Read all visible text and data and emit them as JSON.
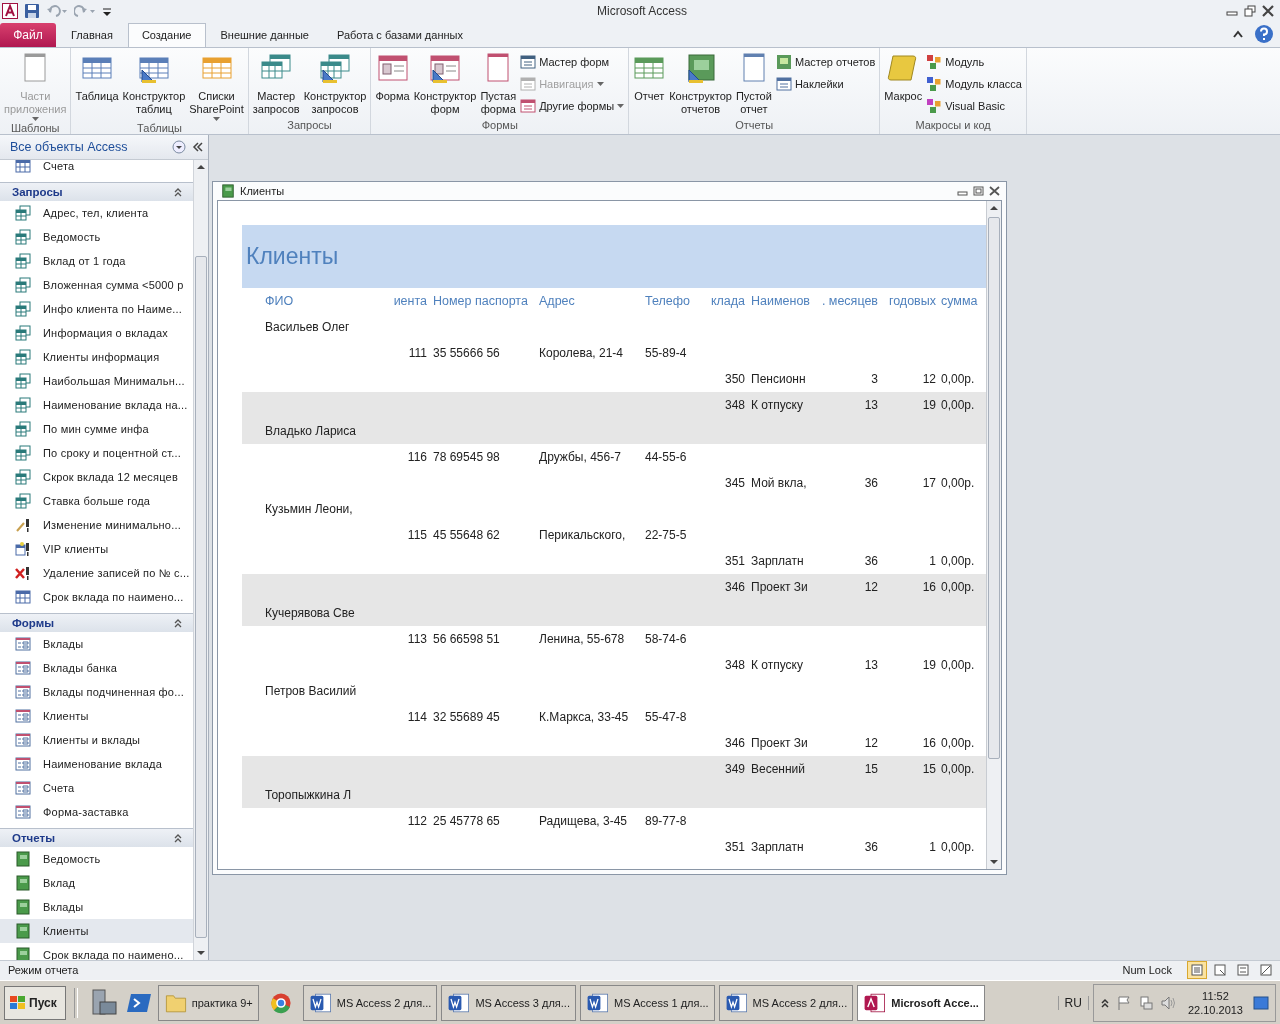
{
  "window": {
    "title": "Microsoft Access"
  },
  "ribbon": {
    "file_tab": "Файл",
    "tabs": [
      {
        "label": "Главная",
        "selected": false
      },
      {
        "label": "Создание",
        "selected": true
      },
      {
        "label": "Внешние данные",
        "selected": false
      },
      {
        "label": "Работа с базами данных",
        "selected": false
      }
    ],
    "groups": [
      {
        "label": "Шаблоны",
        "buttons": [
          {
            "kind": "large",
            "lines": [
              "Части",
              "приложения"
            ],
            "disabled": true,
            "dropdown": true
          }
        ]
      },
      {
        "label": "Таблицы",
        "buttons": [
          {
            "kind": "large",
            "lines": [
              "Таблица"
            ],
            "disabled": false,
            "dropdown": false
          },
          {
            "kind": "large",
            "lines": [
              "Конструктор",
              "таблиц"
            ],
            "disabled": false,
            "dropdown": false
          },
          {
            "kind": "large",
            "lines": [
              "Списки",
              "SharePoint"
            ],
            "disabled": false,
            "dropdown": true
          }
        ]
      },
      {
        "label": "Запросы",
        "buttons": [
          {
            "kind": "large",
            "lines": [
              "Мастер",
              "запросов"
            ],
            "disabled": false,
            "dropdown": false
          },
          {
            "kind": "large",
            "lines": [
              "Конструктор",
              "запросов"
            ],
            "disabled": false,
            "dropdown": false
          }
        ]
      },
      {
        "label": "Формы",
        "buttons": [
          {
            "kind": "large",
            "lines": [
              "Форма"
            ],
            "disabled": false,
            "dropdown": false
          },
          {
            "kind": "large",
            "lines": [
              "Конструктор",
              "форм"
            ],
            "disabled": false,
            "dropdown": false
          },
          {
            "kind": "large",
            "lines": [
              "Пустая",
              "форма"
            ],
            "disabled": false,
            "dropdown": false
          },
          {
            "kind": "small",
            "lines": [
              "Мастер форм"
            ],
            "disabled": false,
            "dropdown": false
          },
          {
            "kind": "small",
            "lines": [
              "Навигация"
            ],
            "disabled": true,
            "dropdown": true
          },
          {
            "kind": "small",
            "lines": [
              "Другие формы"
            ],
            "disabled": false,
            "dropdown": true
          }
        ]
      },
      {
        "label": "Отчеты",
        "buttons": [
          {
            "kind": "large",
            "lines": [
              "Отчет"
            ],
            "disabled": false,
            "dropdown": false
          },
          {
            "kind": "large",
            "lines": [
              "Конструктор",
              "отчетов"
            ],
            "disabled": false,
            "dropdown": false
          },
          {
            "kind": "large",
            "lines": [
              "Пустой",
              "отчет"
            ],
            "disabled": false,
            "dropdown": false
          },
          {
            "kind": "small",
            "lines": [
              "Мастер отчетов"
            ],
            "disabled": false,
            "dropdown": false
          },
          {
            "kind": "small",
            "lines": [
              "Наклейки"
            ],
            "disabled": false,
            "dropdown": false
          }
        ]
      },
      {
        "label": "Макросы и код",
        "buttons": [
          {
            "kind": "large",
            "lines": [
              "Макрос"
            ],
            "disabled": false,
            "dropdown": false
          },
          {
            "kind": "small",
            "lines": [
              "Модуль"
            ],
            "disabled": false,
            "dropdown": false
          },
          {
            "kind": "small",
            "lines": [
              "Модуль класса"
            ],
            "disabled": false,
            "dropdown": false
          },
          {
            "kind": "small",
            "lines": [
              "Visual Basic"
            ],
            "disabled": false,
            "dropdown": false
          }
        ]
      }
    ]
  },
  "nav": {
    "header": "Все объекты Access",
    "groups": [
      {
        "items": [
          {
            "label": "Счета",
            "kind": "table",
            "selected": false
          }
        ]
      },
      {
        "title": "Запросы",
        "items": [
          {
            "label": "Адрес, тел, клиента",
            "kind": "query",
            "selected": false
          },
          {
            "label": "Ведомость",
            "kind": "query",
            "selected": false
          },
          {
            "label": "Вклад от 1 года",
            "kind": "query",
            "selected": false
          },
          {
            "label": "Вложенная сумма <5000 р",
            "kind": "query",
            "selected": false
          },
          {
            "label": "Инфо клиента по Наиме...",
            "kind": "query",
            "selected": false
          },
          {
            "label": "Информация о вкладах",
            "kind": "query",
            "selected": false
          },
          {
            "label": "Клиенты информация",
            "kind": "query",
            "selected": false
          },
          {
            "label": "Наибольшая Минимальн...",
            "kind": "query",
            "selected": false
          },
          {
            "label": "Наименование вклада на...",
            "kind": "query",
            "selected": false
          },
          {
            "label": "По мин сумме инфа",
            "kind": "query",
            "selected": false
          },
          {
            "label": "По сроку и поцентной ст...",
            "kind": "query",
            "selected": false
          },
          {
            "label": "Скрок вклада 12 месяцев",
            "kind": "query",
            "selected": false
          },
          {
            "label": "Ставка больше года",
            "kind": "query",
            "selected": false
          },
          {
            "label": "Изменение минимально...",
            "kind": "update",
            "selected": false
          },
          {
            "label": "VIP клиенты",
            "kind": "maketable",
            "selected": false
          },
          {
            "label": "Удаление записей по № с...",
            "kind": "delete",
            "selected": false
          },
          {
            "label": "Срок вклада по наимено...",
            "kind": "crosstab",
            "selected": false
          }
        ]
      },
      {
        "title": "Формы",
        "items": [
          {
            "label": "Вклады",
            "kind": "form",
            "selected": false
          },
          {
            "label": "Вклады банка",
            "kind": "form",
            "selected": false
          },
          {
            "label": "Вклады подчиненная фо...",
            "kind": "form",
            "selected": false
          },
          {
            "label": "Клиенты",
            "kind": "form",
            "selected": false
          },
          {
            "label": "Клиенты и вклады",
            "kind": "form",
            "selected": false
          },
          {
            "label": "Наименование вклада",
            "kind": "form",
            "selected": false
          },
          {
            "label": "Счета",
            "kind": "form",
            "selected": false
          },
          {
            "label": "Форма-заставка",
            "kind": "form",
            "selected": false
          }
        ]
      },
      {
        "title": "Отчеты",
        "items": [
          {
            "label": "Ведомость",
            "kind": "report",
            "selected": false
          },
          {
            "label": "Вклад",
            "kind": "report",
            "selected": false
          },
          {
            "label": "Вклады",
            "kind": "report",
            "selected": false
          },
          {
            "label": "Клиенты",
            "kind": "report",
            "selected": true
          },
          {
            "label": "Срок вклада по наимено...",
            "kind": "report",
            "selected": false
          }
        ]
      }
    ]
  },
  "report": {
    "window_title": "Клиенты",
    "title": "Клиенты",
    "columns": [
      "ФИО",
      "иента",
      "Номер паспорта",
      "Адрес",
      "Телефо",
      "клада",
      "Наименов",
      ". месяцев",
      "годовых",
      "сумма"
    ],
    "lines": [
      {
        "kind": "name",
        "shaded": false,
        "cells": [
          "Васильев Олег"
        ]
      },
      {
        "kind": "client",
        "shaded": false,
        "cells": [
          "111",
          "35 55666 56",
          "Королева, 21-4",
          "55-89-4"
        ]
      },
      {
        "kind": "deposit",
        "shaded": false,
        "cells": [
          "350",
          "Пенсионн",
          "3",
          "12",
          "0,00р."
        ]
      },
      {
        "kind": "deposit",
        "shaded": true,
        "cells": [
          "348",
          "К отпуску",
          "13",
          "19",
          "0,00р."
        ]
      },
      {
        "kind": "name",
        "shaded": true,
        "cells": [
          "Владько Лариса"
        ]
      },
      {
        "kind": "client",
        "shaded": false,
        "cells": [
          "116",
          "78 69545 98",
          "Дружбы, 456-7",
          "44-55-6"
        ]
      },
      {
        "kind": "deposit",
        "shaded": false,
        "cells": [
          "345",
          "Мой вкла,",
          "36",
          "17",
          "0,00р."
        ]
      },
      {
        "kind": "name",
        "shaded": false,
        "cells": [
          "Кузьмин Леони,"
        ]
      },
      {
        "kind": "client",
        "shaded": false,
        "cells": [
          "115",
          "45 55648 62",
          "Перикальского,",
          "22-75-5"
        ]
      },
      {
        "kind": "deposit",
        "shaded": false,
        "cells": [
          "351",
          "Зарплатн",
          "36",
          "1",
          "0,00р."
        ]
      },
      {
        "kind": "deposit",
        "shaded": true,
        "cells": [
          "346",
          "Проект Зи",
          "12",
          "16",
          "0,00р."
        ]
      },
      {
        "kind": "name",
        "shaded": true,
        "cells": [
          "Кучерявова Све"
        ]
      },
      {
        "kind": "client",
        "shaded": false,
        "cells": [
          "113",
          "56 66598 51",
          "Ленина, 55-678",
          "58-74-6"
        ]
      },
      {
        "kind": "deposit",
        "shaded": false,
        "cells": [
          "348",
          "К отпуску",
          "13",
          "19",
          "0,00р."
        ]
      },
      {
        "kind": "name",
        "shaded": false,
        "cells": [
          "Петров Василий"
        ]
      },
      {
        "kind": "client",
        "shaded": false,
        "cells": [
          "114",
          "32 55689 45",
          "К.Маркса, 33-45",
          "55-47-8"
        ]
      },
      {
        "kind": "deposit",
        "shaded": false,
        "cells": [
          "346",
          "Проект Зи",
          "12",
          "16",
          "0,00р."
        ]
      },
      {
        "kind": "deposit",
        "shaded": true,
        "cells": [
          "349",
          "Весенний",
          "15",
          "15",
          "0,00р."
        ]
      },
      {
        "kind": "name",
        "shaded": true,
        "cells": [
          "Торопыжкина Л"
        ]
      },
      {
        "kind": "client",
        "shaded": false,
        "cells": [
          "112",
          "25 45778 65",
          "Радищева, 3-45",
          "89-77-8"
        ]
      },
      {
        "kind": "deposit",
        "shaded": false,
        "cells": [
          "351",
          "Зарплатн",
          "36",
          "1",
          "0,00р."
        ]
      }
    ]
  },
  "status_bar": {
    "mode": "Режим отчета",
    "num_lock": "Num Lock",
    "views": [
      {
        "kind": "report",
        "selected": true
      },
      {
        "kind": "print",
        "selected": false
      },
      {
        "kind": "layout",
        "selected": false
      },
      {
        "kind": "design",
        "selected": false
      }
    ]
  },
  "taskbar": {
    "start": "Пуск",
    "tasks": [
      {
        "kind": "folder",
        "label": "практика 9+",
        "selected": false
      },
      {
        "kind": "chrome",
        "selected": false
      },
      {
        "kind": "word",
        "label": "MS Access 2 для...",
        "selected": false
      },
      {
        "kind": "word",
        "label": "MS Access 3 для...",
        "selected": false
      },
      {
        "kind": "word",
        "label": "MS Access 1 для...",
        "selected": false
      },
      {
        "kind": "word",
        "label": "MS Access 2 для...",
        "selected": false
      },
      {
        "kind": "access",
        "label": "Microsoft Acce...",
        "selected": true
      }
    ],
    "language": "RU",
    "time": "11:52",
    "date": "22.10.2013"
  }
}
